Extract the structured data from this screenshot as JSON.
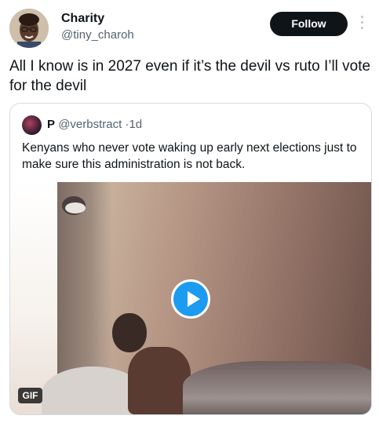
{
  "author": {
    "display_name": "Charity",
    "handle": "@tiny_charoh",
    "avatar_icon": "profile-photo"
  },
  "follow_button": {
    "label": "Follow"
  },
  "more_options_icon": "vertical-ellipsis-icon",
  "tweet": {
    "text": "All I know is in 2027 even if it’s the devil vs ruto I’ll vote for the devil"
  },
  "quoted_tweet": {
    "display_name": "P",
    "handle": "@verbstract",
    "separator": "·",
    "timestamp": "1d",
    "text": "Kenyans who never vote waking up early next elections just to make sure this administration is not back.",
    "media": {
      "badge": "GIF",
      "play_icon": "play-icon"
    }
  },
  "colors": {
    "follow_bg": "#0f1419",
    "play_blue": "#1d9bf0",
    "secondary_text": "#536471"
  }
}
